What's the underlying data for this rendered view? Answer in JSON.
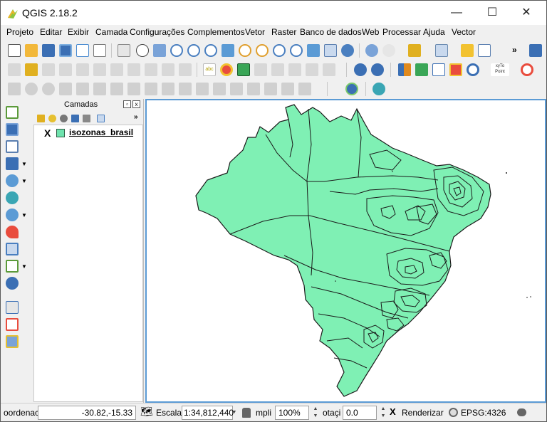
{
  "window": {
    "title": "QGIS 2.18.2",
    "minimize_glyph": "—",
    "maximize_glyph": "☐",
    "close_glyph": "✕"
  },
  "menu": [
    "Projeto",
    "Editar",
    "Exibir",
    "Camada",
    "Configurações",
    "Complementos",
    "Vetor",
    "Raster",
    "Banco de dados",
    "Web",
    "Processar",
    "Ajuda",
    "Vector"
  ],
  "toolbar_overflow": "»",
  "icon_text": {
    "abc": "abc",
    "xy_to_point": "xyTo Point"
  },
  "layers_panel": {
    "title": "Camadas",
    "overflow": "»",
    "float_glyph": "🗗",
    "close_glyph": "x",
    "layers": [
      {
        "visible_mark": "X",
        "name": "isozonas_brasil",
        "color": "#6fe3ae"
      }
    ]
  },
  "map": {
    "fill_color": "#7ff0b4",
    "stroke_color": "#1a1a1a"
  },
  "status": {
    "coord_label": "oordenac",
    "coord_value": "-30.82,-15.33",
    "scale_label": "Escala",
    "scale_value": "1:34,812,440",
    "magnify_label": "mpli",
    "magnify_value": "100%",
    "rotation_label": "otaçi",
    "rotation_value": "0.0",
    "render_mark": "X",
    "render_label": "Renderizar",
    "crs_value": "EPSG:4326"
  }
}
